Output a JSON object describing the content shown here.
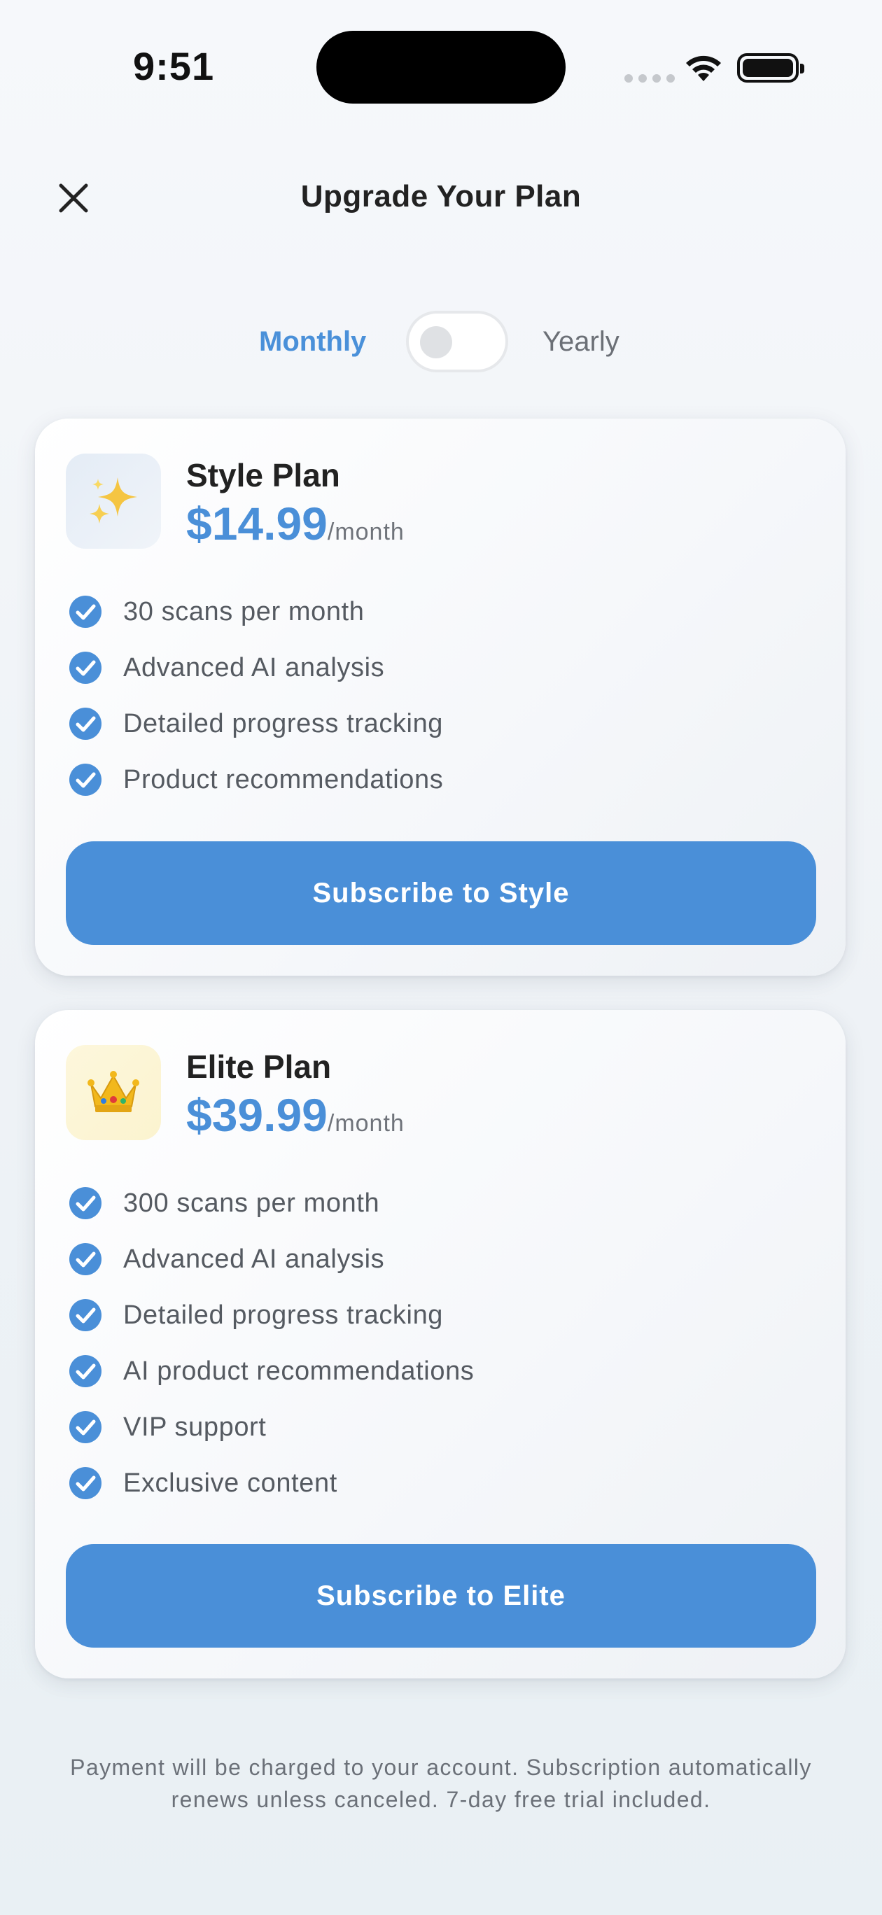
{
  "status_bar": {
    "time": "9:51"
  },
  "header": {
    "title": "Upgrade Your Plan",
    "close_icon": "close-icon"
  },
  "billing_toggle": {
    "monthly_label": "Monthly",
    "yearly_label": "Yearly",
    "selected": "Monthly"
  },
  "plans": [
    {
      "icon": "sparkles-emoji",
      "icon_glyph": "✨",
      "name": "Style Plan",
      "price": "$14.99",
      "period": "/month",
      "features": [
        "30 scans per month",
        "Advanced AI analysis",
        "Detailed progress tracking",
        "Product recommendations"
      ],
      "button_label": "Subscribe to Style"
    },
    {
      "icon": "crown-emoji",
      "icon_glyph": "👑",
      "name": "Elite Plan",
      "price": "$39.99",
      "period": "/month",
      "features": [
        "300 scans per month",
        "Advanced AI analysis",
        "Detailed progress tracking",
        "AI product recommendations",
        "VIP support",
        "Exclusive content"
      ],
      "button_label": "Subscribe to Elite"
    }
  ],
  "footer": {
    "note": "Payment will be charged to your account. Subscription automatically renews unless canceled. 7-day free trial included."
  },
  "colors": {
    "accent": "#4a8fd8",
    "text_primary": "#222222",
    "text_secondary": "#555a61"
  }
}
